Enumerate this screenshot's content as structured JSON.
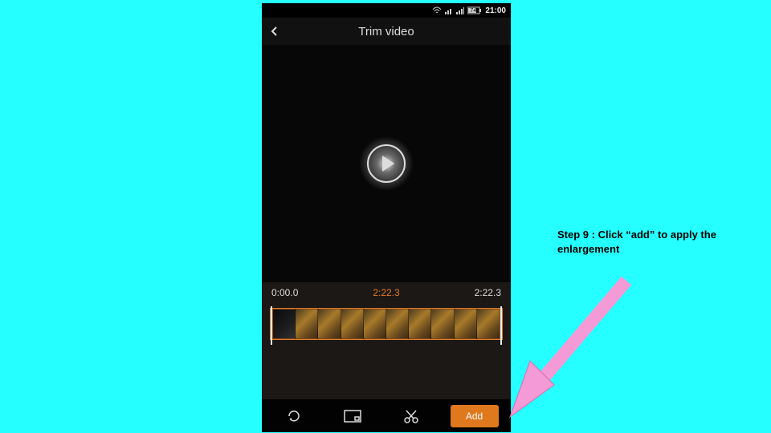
{
  "statusbar": {
    "battery": "74",
    "time": "21:00"
  },
  "titlebar": {
    "title": "Trim video"
  },
  "times": {
    "start": "0:00.0",
    "mid": "2:22.3",
    "end": "2:22.3"
  },
  "timeline": {
    "thumbs_count": 10
  },
  "toolbar": {
    "add_label": "Add"
  },
  "annotation": {
    "step_bold": "Step 9 : Click  “add” to apply the",
    "step_rest": "enlargement"
  },
  "colors": {
    "accent": "#e0781e",
    "arrow": "#f49ad6"
  }
}
